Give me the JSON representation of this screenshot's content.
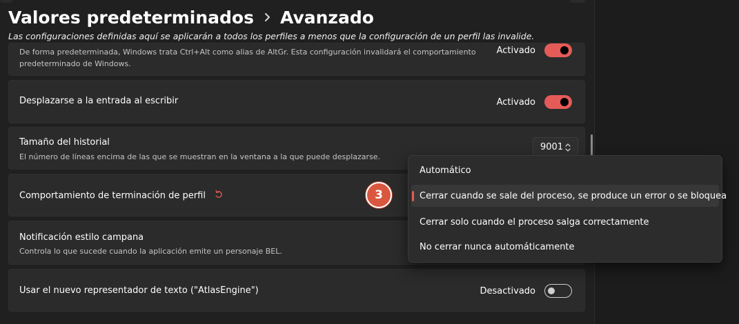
{
  "header": {
    "breadcrumb_parent": "Valores predeterminados",
    "breadcrumb_current": "Avanzado",
    "subtitle": "Las configuraciones definidas aquí se aplicarán a todos los perfiles a menos que la configuración de un perfil las invalide."
  },
  "settings": {
    "altgr": {
      "desc_line1": "De forma predeterminada, Windows trata Ctrl+Alt como alias de AltGr. Esta configuración invalidará el comportamiento",
      "desc_line2": "predeterminado de Windows.",
      "state": "Activado"
    },
    "scroll_to_input": {
      "title": "Desplazarse a la entrada al escribir",
      "state": "Activado"
    },
    "history_size": {
      "title": "Tamaño del historial",
      "desc": "El número de líneas encima de las que se muestran en la ventana a la que puede desplazarse.",
      "value": "9001"
    },
    "close_behavior": {
      "title": "Comportamiento de terminación de perfil"
    },
    "bell": {
      "title": "Notificación estilo campana",
      "desc": "Controla lo que sucede cuando la aplicación emite un personaje BEL."
    },
    "atlas": {
      "title": "Usar el nuevo representador de texto (\"AtlasEngine\")",
      "state": "Desactivado"
    }
  },
  "step_badge": "3",
  "dropdown": {
    "options": [
      "Automático",
      "Cerrar cuando se sale del proceso, se produce un error o se bloquea",
      "Cerrar solo cuando el proceso salga correctamente",
      "No cerrar nunca automáticamente"
    ],
    "selected_index": 1
  },
  "colors": {
    "accent": "#e55b58",
    "badge": "#d9573f",
    "card_bg": "#2b2b2b",
    "page_bg": "#202020"
  },
  "icons": {
    "breadcrumb_separator": "chevron-right-icon",
    "reset": "reset-icon",
    "spinner": "spin-updown-icon"
  }
}
